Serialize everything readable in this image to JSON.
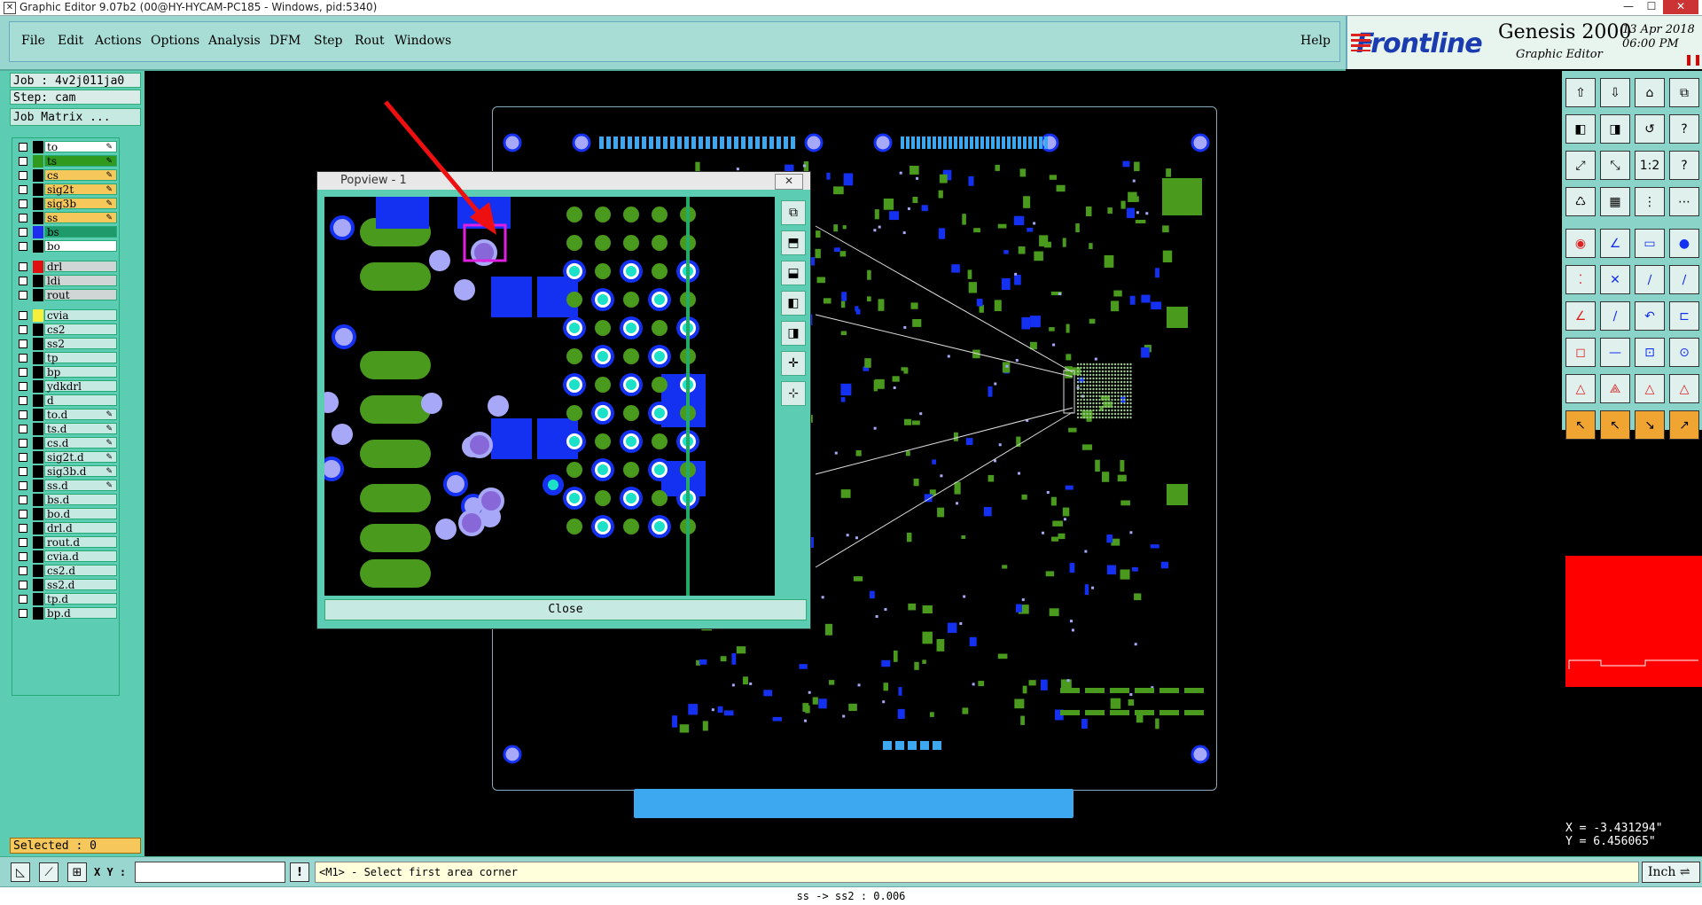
{
  "window": {
    "title": "Graphic Editor 9.07b2 (00@HY-HYCAM-PC185 - Windows, pid:5340)"
  },
  "menu": {
    "items": [
      "File",
      "Edit",
      "Actions",
      "Options",
      "Analysis",
      "DFM",
      "Step",
      "Rout",
      "Windows"
    ],
    "help": "Help"
  },
  "brand": {
    "logo": "Frontline",
    "product": "Genesis 2000",
    "subtitle": "Graphic Editor",
    "date": "13 Apr 2018",
    "time": "06:00 PM"
  },
  "job": {
    "job": "Job : 4v2j011ja0",
    "step": "Step: cam",
    "matrix_button": "Job Matrix ..."
  },
  "layers": [
    {
      "name": "to",
      "color": "#000000",
      "bg": "#ffffff",
      "editable": true
    },
    {
      "name": "ts",
      "color": "#2f9a1e",
      "bg": "#2f9a1e",
      "editable": true
    },
    {
      "name": "cs",
      "color": "#000000",
      "bg": "#f6c75a",
      "editable": true
    },
    {
      "name": "sig2t",
      "color": "#000000",
      "bg": "#f6c75a",
      "editable": true
    },
    {
      "name": "sig3b",
      "color": "#000000",
      "bg": "#f6c75a",
      "editable": true
    },
    {
      "name": "ss",
      "color": "#000000",
      "bg": "#f6c75a",
      "editable": true
    },
    {
      "name": "bs",
      "color": "#1e2ef0",
      "bg": "#1f9a6a",
      "editable": false
    },
    {
      "name": "bo",
      "color": "#000000",
      "bg": "#ffffff",
      "editable": false
    },
    {
      "name": "drl",
      "color": "#e01010",
      "bg": "#d0d6d6",
      "editable": false
    },
    {
      "name": "ldi",
      "color": "#000000",
      "bg": "#d0d6d6",
      "editable": false
    },
    {
      "name": "rout",
      "color": "#000000",
      "bg": "#d0d6d6",
      "editable": false
    },
    {
      "name": "cvia",
      "color": "#f6f03a",
      "bg": "#c6eae2",
      "editable": false
    },
    {
      "name": "cs2",
      "color": "#000000",
      "bg": "#c6eae2",
      "editable": false
    },
    {
      "name": "ss2",
      "color": "#000000",
      "bg": "#c6eae2",
      "editable": false
    },
    {
      "name": "tp",
      "color": "#000000",
      "bg": "#c6eae2",
      "editable": false
    },
    {
      "name": "bp",
      "color": "#000000",
      "bg": "#c6eae2",
      "editable": false
    },
    {
      "name": "ydkdrl",
      "color": "#000000",
      "bg": "#c6eae2",
      "editable": false
    },
    {
      "name": "d",
      "color": "#000000",
      "bg": "#c6eae2",
      "editable": false
    },
    {
      "name": "to.d",
      "color": "#000000",
      "bg": "#c6eae2",
      "editable": true
    },
    {
      "name": "ts.d",
      "color": "#000000",
      "bg": "#c6eae2",
      "editable": true
    },
    {
      "name": "cs.d",
      "color": "#000000",
      "bg": "#c6eae2",
      "editable": true
    },
    {
      "name": "sig2t.d",
      "color": "#000000",
      "bg": "#c6eae2",
      "editable": true
    },
    {
      "name": "sig3b.d",
      "color": "#000000",
      "bg": "#c6eae2",
      "editable": true
    },
    {
      "name": "ss.d",
      "color": "#000000",
      "bg": "#c6eae2",
      "editable": true
    },
    {
      "name": "bs.d",
      "color": "#000000",
      "bg": "#c6eae2",
      "editable": false
    },
    {
      "name": "bo.d",
      "color": "#000000",
      "bg": "#c6eae2",
      "editable": false
    },
    {
      "name": "drl.d",
      "color": "#000000",
      "bg": "#c6eae2",
      "editable": false
    },
    {
      "name": "rout.d",
      "color": "#000000",
      "bg": "#c6eae2",
      "editable": false
    },
    {
      "name": "cvia.d",
      "color": "#000000",
      "bg": "#c6eae2",
      "editable": false
    },
    {
      "name": "cs2.d",
      "color": "#000000",
      "bg": "#c6eae2",
      "editable": false
    },
    {
      "name": "ss2.d",
      "color": "#000000",
      "bg": "#c6eae2",
      "editable": false
    },
    {
      "name": "tp.d",
      "color": "#000000",
      "bg": "#c6eae2",
      "editable": false
    },
    {
      "name": "bp.d",
      "color": "#000000",
      "bg": "#c6eae2",
      "editable": false
    }
  ],
  "selected": "Selected : 0",
  "popview": {
    "title": "Popview - 1",
    "close_label": "Close"
  },
  "coords": {
    "x": "X = -3.431294\"",
    "y": "Y = 6.456065\""
  },
  "status": {
    "xy_label": "X Y :",
    "xy_value": "",
    "message": "<M1> - Select first area corner",
    "unit": "Inch"
  },
  "footer": "ss -> ss2 : 0.006",
  "colors": {
    "accent": "#5ccdb2",
    "menu": "#9ad6d0",
    "pad_green": "#4a9a1e",
    "pad_blue": "#1430f0",
    "via_light": "#a8a8f8",
    "highlight": "#e020e0",
    "arrow": "#ee1010"
  }
}
